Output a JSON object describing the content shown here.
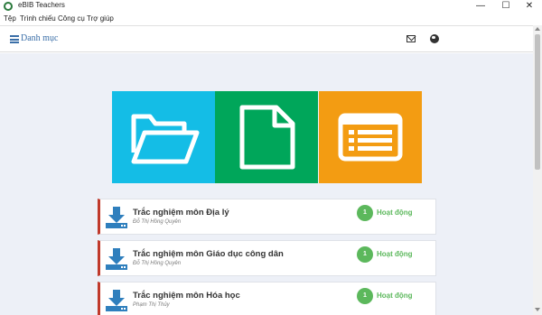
{
  "window": {
    "title": "eBIB Teachers",
    "controls": {
      "minimize": "—",
      "maximize": "☐",
      "close": "✕"
    }
  },
  "menubar": {
    "items": [
      "Tệp",
      "Trình chiếu",
      "Công cụ",
      "Trợ giúp"
    ]
  },
  "navbar": {
    "title": "Danh mục",
    "icons": [
      "menu-icon",
      "mail-icon",
      "globe-icon"
    ]
  },
  "tiles": [
    {
      "icon": "folder-open-icon",
      "color": "#14bde6"
    },
    {
      "icon": "document-icon",
      "color": "#00a65a"
    },
    {
      "icon": "list-window-icon",
      "color": "#f39c12"
    }
  ],
  "tests": [
    {
      "title": "Trắc nghiệm môn Địa lý",
      "author": "Đỗ Thị Hồng Quyên",
      "count": "1",
      "status": "Hoạt động"
    },
    {
      "title": "Trắc nghiệm môn Giáo dục công dân",
      "author": "Đỗ Thị Hồng Quyên",
      "count": "1",
      "status": "Hoạt động"
    },
    {
      "title": "Trắc nghiệm môn Hóa học",
      "author": "Phạm Thị Thủy",
      "count": "1",
      "status": "Hoạt động"
    }
  ],
  "colors": {
    "accent_blue": "#3b6fa8",
    "status_green": "#5cb85c",
    "card_border": "#c0392b",
    "background": "#edf0f7"
  }
}
